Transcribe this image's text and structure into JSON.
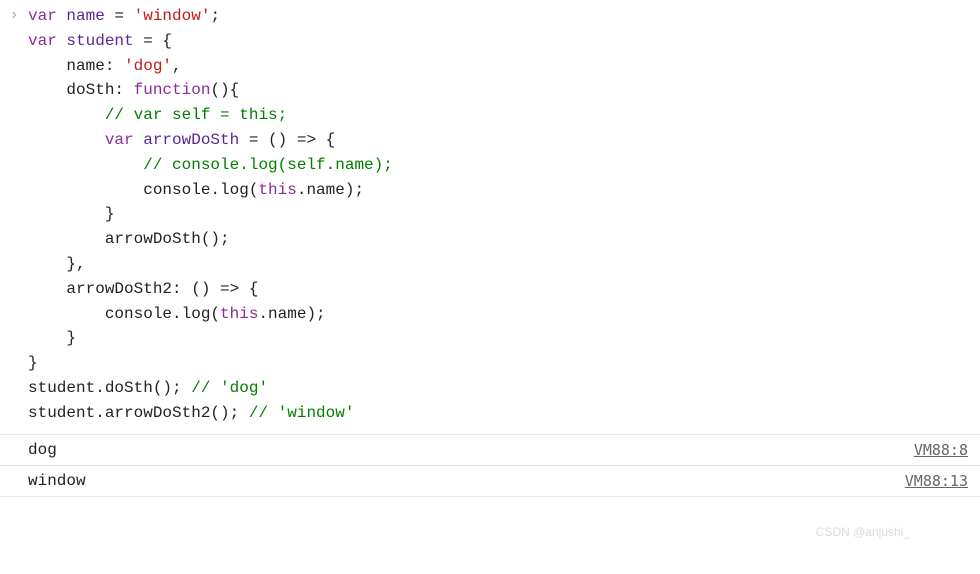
{
  "input": {
    "prompt_icon": "›",
    "tokens": [
      {
        "t": "var ",
        "c": "kw"
      },
      {
        "t": "name",
        "c": "name"
      },
      {
        "t": " = ",
        "c": "plain"
      },
      {
        "t": "'window'",
        "c": "str"
      },
      {
        "t": ";",
        "c": "plain"
      },
      {
        "t": "\n",
        "c": "plain"
      },
      {
        "t": "var ",
        "c": "kw"
      },
      {
        "t": "student",
        "c": "name"
      },
      {
        "t": " = {",
        "c": "plain"
      },
      {
        "t": "\n",
        "c": "plain"
      },
      {
        "t": "    name: ",
        "c": "plain"
      },
      {
        "t": "'dog'",
        "c": "str"
      },
      {
        "t": ",",
        "c": "plain"
      },
      {
        "t": "\n",
        "c": "plain"
      },
      {
        "t": "    doSth: ",
        "c": "plain"
      },
      {
        "t": "function",
        "c": "kw"
      },
      {
        "t": "(){",
        "c": "plain"
      },
      {
        "t": "\n",
        "c": "plain"
      },
      {
        "t": "        ",
        "c": "plain"
      },
      {
        "t": "// var self = this;",
        "c": "com"
      },
      {
        "t": "\n",
        "c": "plain"
      },
      {
        "t": "        ",
        "c": "plain"
      },
      {
        "t": "var ",
        "c": "kw"
      },
      {
        "t": "arrowDoSth",
        "c": "name"
      },
      {
        "t": " = () => {",
        "c": "plain"
      },
      {
        "t": "\n",
        "c": "plain"
      },
      {
        "t": "            ",
        "c": "plain"
      },
      {
        "t": "// console.log(self.name);",
        "c": "com"
      },
      {
        "t": "\n",
        "c": "plain"
      },
      {
        "t": "            console.log(",
        "c": "plain"
      },
      {
        "t": "this",
        "c": "kw"
      },
      {
        "t": ".name);",
        "c": "plain"
      },
      {
        "t": "\n",
        "c": "plain"
      },
      {
        "t": "        }",
        "c": "plain"
      },
      {
        "t": "\n",
        "c": "plain"
      },
      {
        "t": "        arrowDoSth();",
        "c": "plain"
      },
      {
        "t": "\n",
        "c": "plain"
      },
      {
        "t": "    },",
        "c": "plain"
      },
      {
        "t": "\n",
        "c": "plain"
      },
      {
        "t": "    arrowDoSth2: () => {",
        "c": "plain"
      },
      {
        "t": "\n",
        "c": "plain"
      },
      {
        "t": "        console.log(",
        "c": "plain"
      },
      {
        "t": "this",
        "c": "kw"
      },
      {
        "t": ".name);",
        "c": "plain"
      },
      {
        "t": "\n",
        "c": "plain"
      },
      {
        "t": "    }",
        "c": "plain"
      },
      {
        "t": "\n",
        "c": "plain"
      },
      {
        "t": "}",
        "c": "plain"
      },
      {
        "t": "\n",
        "c": "plain"
      },
      {
        "t": "student.doSth(); ",
        "c": "plain"
      },
      {
        "t": "// 'dog'",
        "c": "com"
      },
      {
        "t": "\n",
        "c": "plain"
      },
      {
        "t": "student.arrowDoSth2(); ",
        "c": "plain"
      },
      {
        "t": "// 'window'",
        "c": "com"
      }
    ]
  },
  "logs": [
    {
      "text": "dog",
      "source": "VM88:8"
    },
    {
      "text": "window",
      "source": "VM88:13"
    }
  ],
  "watermark": "CSDN @anjushi_"
}
